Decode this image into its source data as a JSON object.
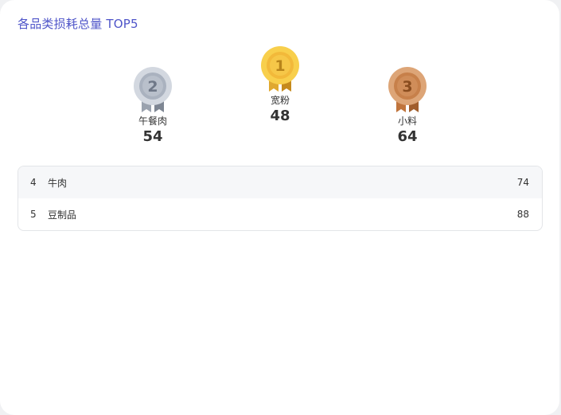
{
  "title": "各品类损耗总量 TOP5",
  "podium": [
    {
      "rank": "1",
      "name": "宽粉",
      "value": "48",
      "medal": "gold-medal-icon",
      "colors": {
        "outer": "#f8cf4c",
        "inner": "#f2b93a",
        "text": "#b8841a",
        "ribbon": "#e0a830",
        "ribbonDark": "#c58a1c"
      }
    },
    {
      "rank": "2",
      "name": "午餐肉",
      "value": "54",
      "medal": "silver-medal-icon",
      "colors": {
        "outer": "#d3d8e0",
        "inner": "#aab2bf",
        "text": "#6f7888",
        "ribbon": "#9aa2ae",
        "ribbonDark": "#7e8693"
      }
    },
    {
      "rank": "3",
      "name": "小料",
      "value": "64",
      "medal": "bronze-medal-icon",
      "colors": {
        "outer": "#dda577",
        "inner": "#c7804a",
        "text": "#8a4d1f",
        "ribbon": "#c0743c",
        "ribbonDark": "#a15e2c"
      }
    }
  ],
  "list": [
    {
      "rank": "4",
      "name": "牛肉",
      "value": "74"
    },
    {
      "rank": "5",
      "name": "豆制品",
      "value": "88"
    }
  ]
}
